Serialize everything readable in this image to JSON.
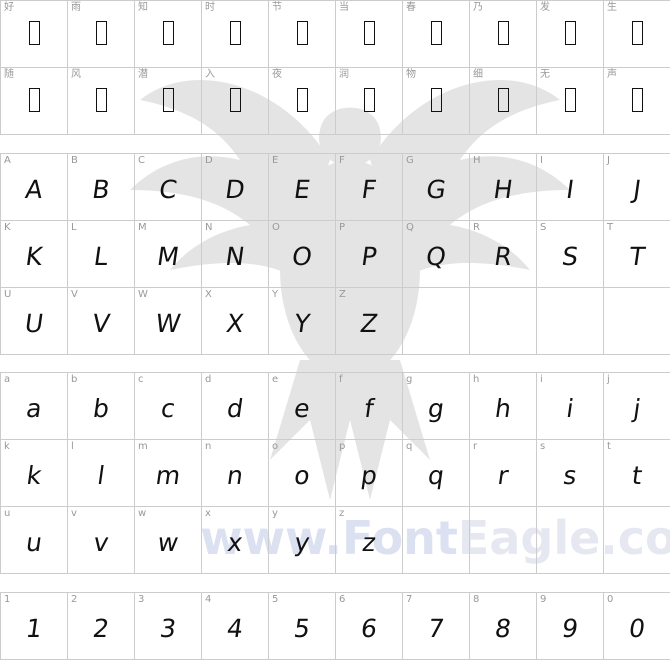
{
  "sections": {
    "cjk": [
      "好",
      "雨",
      "知",
      "时",
      "节",
      "当",
      "春",
      "乃",
      "发",
      "生",
      "随",
      "风",
      "潜",
      "入",
      "夜",
      "润",
      "物",
      "细",
      "无",
      "声"
    ],
    "upper": [
      "A",
      "B",
      "C",
      "D",
      "E",
      "F",
      "G",
      "H",
      "I",
      "J",
      "K",
      "L",
      "M",
      "N",
      "O",
      "P",
      "Q",
      "R",
      "S",
      "T",
      "U",
      "V",
      "W",
      "X",
      "Y",
      "Z"
    ],
    "lower": [
      "a",
      "b",
      "c",
      "d",
      "e",
      "f",
      "g",
      "h",
      "i",
      "j",
      "k",
      "l",
      "m",
      "n",
      "o",
      "p",
      "q",
      "r",
      "s",
      "t",
      "u",
      "v",
      "w",
      "x",
      "y",
      "z"
    ],
    "digits": [
      "1",
      "2",
      "3",
      "4",
      "5",
      "6",
      "7",
      "8",
      "9",
      "0"
    ]
  },
  "watermark": {
    "part1": "www.Font",
    "part2": "Eagle.com"
  },
  "colors": {
    "grid_line": "#cccccc",
    "label": "#999999",
    "glyph": "#111111"
  },
  "icons": {
    "background": "eagle-watermark-icon",
    "missing_glyph": "tofu-box-icon"
  }
}
